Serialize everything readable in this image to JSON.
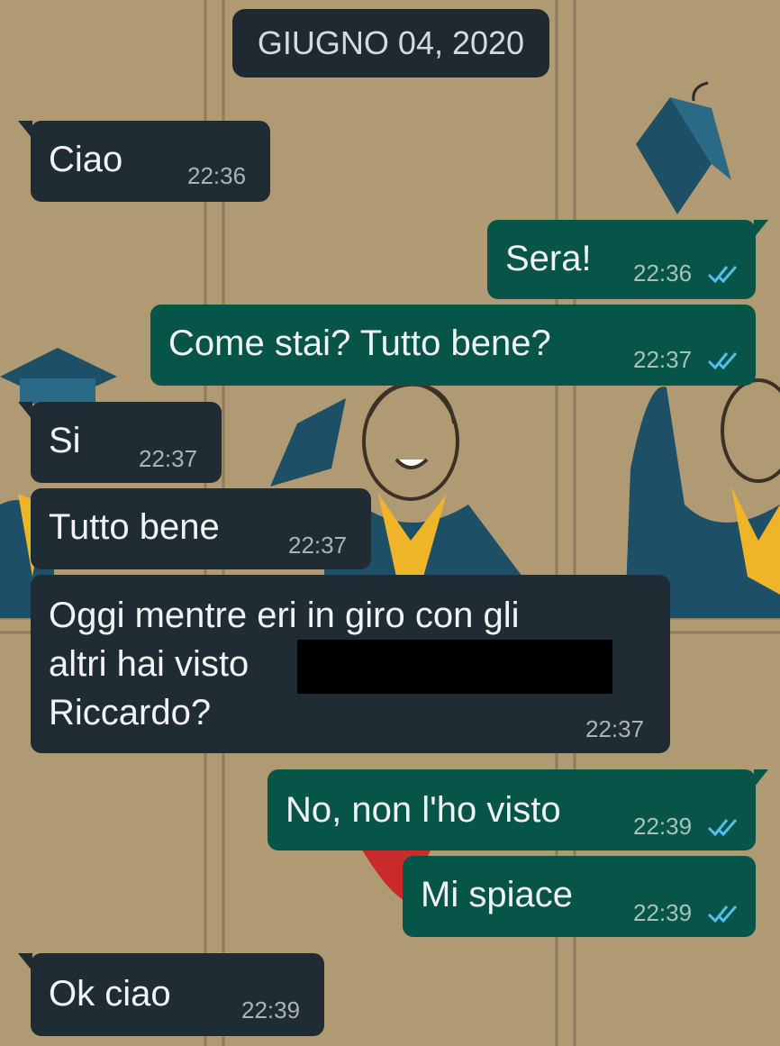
{
  "date_chip": "GIUGNO 04, 2020",
  "messages": [
    {
      "text": "Ciao",
      "time": "22:36",
      "direction": "in"
    },
    {
      "text": "Sera!",
      "time": "22:36",
      "direction": "out",
      "status": "read"
    },
    {
      "text": "Come stai? Tutto bene?",
      "time": "22:37",
      "direction": "out",
      "status": "read"
    },
    {
      "text": "Si",
      "time": "22:37",
      "direction": "in"
    },
    {
      "text": "Tutto bene",
      "time": "22:37",
      "direction": "in"
    },
    {
      "lines": [
        "Oggi mentre eri in giro con gli",
        "altri hai visto",
        "Riccardo?"
      ],
      "time": "22:37",
      "direction": "in",
      "redacted": true
    },
    {
      "text": "No, non l'ho visto",
      "time": "22:39",
      "direction": "out",
      "status": "read"
    },
    {
      "text": "Mi spiace",
      "time": "22:39",
      "direction": "out",
      "status": "read"
    },
    {
      "text": "Ok ciao",
      "time": "22:39",
      "direction": "in"
    }
  ],
  "colors": {
    "wallpaper": "#b09a74",
    "incoming_bubble": "#1f2c34",
    "outgoing_bubble": "#075449",
    "read_ticks": "#53bdeb",
    "wallpaper_accent_blue": "#1d4f66",
    "wallpaper_accent_yellow": "#f0b429"
  },
  "icons": {
    "read_receipt": "double-check-icon"
  }
}
